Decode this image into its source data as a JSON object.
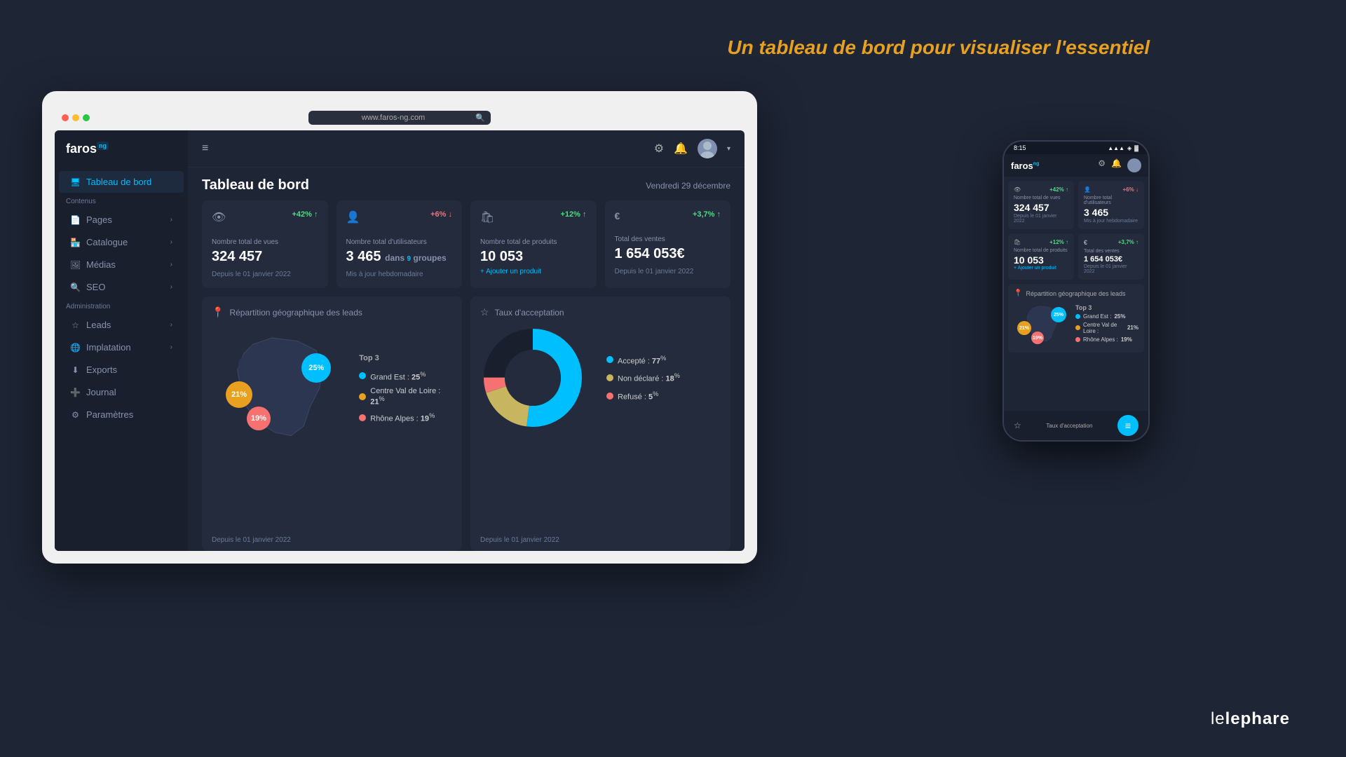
{
  "hero": {
    "text_before": "Un tableau de bord pour visualiser l'",
    "text_highlight": "essentiel"
  },
  "browser": {
    "url": "www.faros-ng.com"
  },
  "app": {
    "logo": "faros",
    "logo_sup": "ng"
  },
  "sidebar": {
    "dashboard_label": "Tableau de bord",
    "contenus_label": "Contenus",
    "administration_label": "Administration",
    "items": [
      {
        "label": "Pages",
        "icon": "📄",
        "has_chevron": true
      },
      {
        "label": "Catalogue",
        "icon": "🏪",
        "has_chevron": true
      },
      {
        "label": "Médias",
        "icon": "🖼",
        "has_chevron": true
      },
      {
        "label": "SEO",
        "icon": "🔍",
        "has_chevron": true
      },
      {
        "label": "Leads",
        "icon": "☆",
        "has_chevron": true
      },
      {
        "label": "Implatation",
        "icon": "🌐",
        "has_chevron": true
      },
      {
        "label": "Exports",
        "icon": "⬇",
        "has_chevron": false
      },
      {
        "label": "Journal",
        "icon": "➕",
        "has_chevron": false
      },
      {
        "label": "Paramètres",
        "icon": "⚙",
        "has_chevron": false
      }
    ]
  },
  "topbar": {
    "menu_icon": "≡",
    "date_text": "Vendredi 29 décembre"
  },
  "page": {
    "title": "Tableau de bord"
  },
  "stat_cards": [
    {
      "icon": "👁",
      "badge": "+42% ↑",
      "badge_type": "green",
      "label": "Nombre total de vues",
      "value": "324 457",
      "footer": "Depuis le 01 janvier 2022"
    },
    {
      "icon": "👤",
      "badge": "+6% ↓",
      "badge_type": "red",
      "label": "Nombre total d'utilisateurs",
      "value": "3 465",
      "sub": "dans",
      "groups": "9",
      "groups_suffix": "groupes",
      "footer": "Mis à jour hebdomadaire"
    },
    {
      "icon": "🛍",
      "badge": "+12% ↑",
      "badge_type": "green",
      "label": "Nombre total de produits",
      "value": "10 053",
      "link": "+ Ajouter un produit",
      "footer": ""
    },
    {
      "icon": "€",
      "badge": "+3,7% ↑",
      "badge_type": "green",
      "label": "Total des ventes",
      "value": "1 654 053€",
      "footer": "Depuis le 01 janvier 2022"
    }
  ],
  "geo_card": {
    "icon": "📍",
    "title": "Répartition géographique des leads",
    "footer": "Depuis le 01 janvier 2022",
    "legend_title": "Top 3",
    "bubbles": [
      {
        "label": "25%",
        "color": "#00bfff",
        "pct": 25
      },
      {
        "label": "21%",
        "color": "#e8a020",
        "pct": 21
      },
      {
        "label": "19%",
        "color": "#f87171",
        "pct": 19
      }
    ],
    "legend": [
      {
        "label": "Grand Est : ",
        "pct": "25",
        "color": "#00bfff"
      },
      {
        "label": "Centre Val de Loire : ",
        "pct": "21",
        "color": "#e8a020"
      },
      {
        "label": "Rhône Alpes : ",
        "pct": "19",
        "color": "#f87171"
      }
    ]
  },
  "acceptance_card": {
    "icon": "☆",
    "title": "Taux d'acceptation",
    "footer": "Depuis le 01 janvier 2022",
    "donut": [
      {
        "label": "Accepté : ",
        "pct": 77,
        "color": "#00bfff"
      },
      {
        "label": "Non déclaré : ",
        "pct": 18,
        "color": "#c8b560"
      },
      {
        "label": "Refusé : ",
        "pct": 5,
        "color": "#f87171"
      }
    ]
  },
  "phone": {
    "time": "8:15",
    "signal": "▲▲▲",
    "wifi": "wifi",
    "battery": "🔋"
  },
  "brand": {
    "text": "lephare"
  }
}
